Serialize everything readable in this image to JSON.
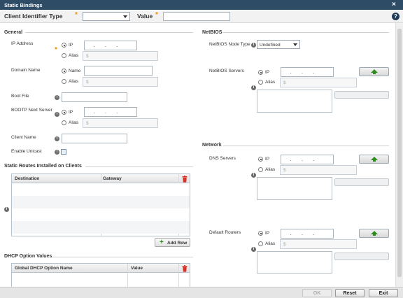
{
  "window": {
    "title": "Static Bindings",
    "close_icon": "close-icon",
    "help_glyph": "?"
  },
  "ident": {
    "type_label": "Client Identifier Type",
    "type_value": "",
    "value_label": "Value",
    "value_value": ""
  },
  "general": {
    "title": "General",
    "ip_address": {
      "label": "IP Address",
      "opt_ip": "IP",
      "opt_alias": "Alias",
      "alias_ph": "$"
    },
    "domain_name": {
      "label": "Domain Name",
      "opt_name": "Name",
      "opt_alias": "Alias",
      "alias_ph": "$"
    },
    "boot_file": {
      "label": "Boot File"
    },
    "bootp": {
      "label": "BOOTP Next Server",
      "opt_ip": "IP",
      "opt_alias": "Alias",
      "alias_ph": "$"
    },
    "client_name": {
      "label": "Client Name"
    },
    "unicast": {
      "label": "Enable Unicast"
    }
  },
  "static_routes": {
    "title": "Static Routes Installed on Clients",
    "columns": [
      "Destination",
      "Gateway"
    ],
    "rows": [],
    "add_row": "Add Row"
  },
  "dhcp": {
    "title": "DHCP Option Values",
    "columns": [
      "Global DHCP Option Name",
      "Value"
    ]
  },
  "netbios": {
    "title": "NetBIOS",
    "node_type_label": "NetBIOS Node Type",
    "node_type_value": "Undefined",
    "servers_label": "NetBIOS Servers",
    "opt_ip": "IP",
    "opt_alias": "Alias",
    "alias_ph": "$"
  },
  "network": {
    "title": "Network",
    "dns_label": "DNS Servers",
    "routers_label": "Default Routers",
    "opt_ip": "IP",
    "opt_alias": "Alias",
    "alias_ph": "$"
  },
  "footer": {
    "ok": "OK",
    "reset": "Reset",
    "exit": "Exit"
  },
  "colors": {
    "titlebar": "#2e4c66",
    "accent_star": "#f08c00",
    "trash": "#d9342b",
    "add_icon": "#2e8b1e"
  }
}
